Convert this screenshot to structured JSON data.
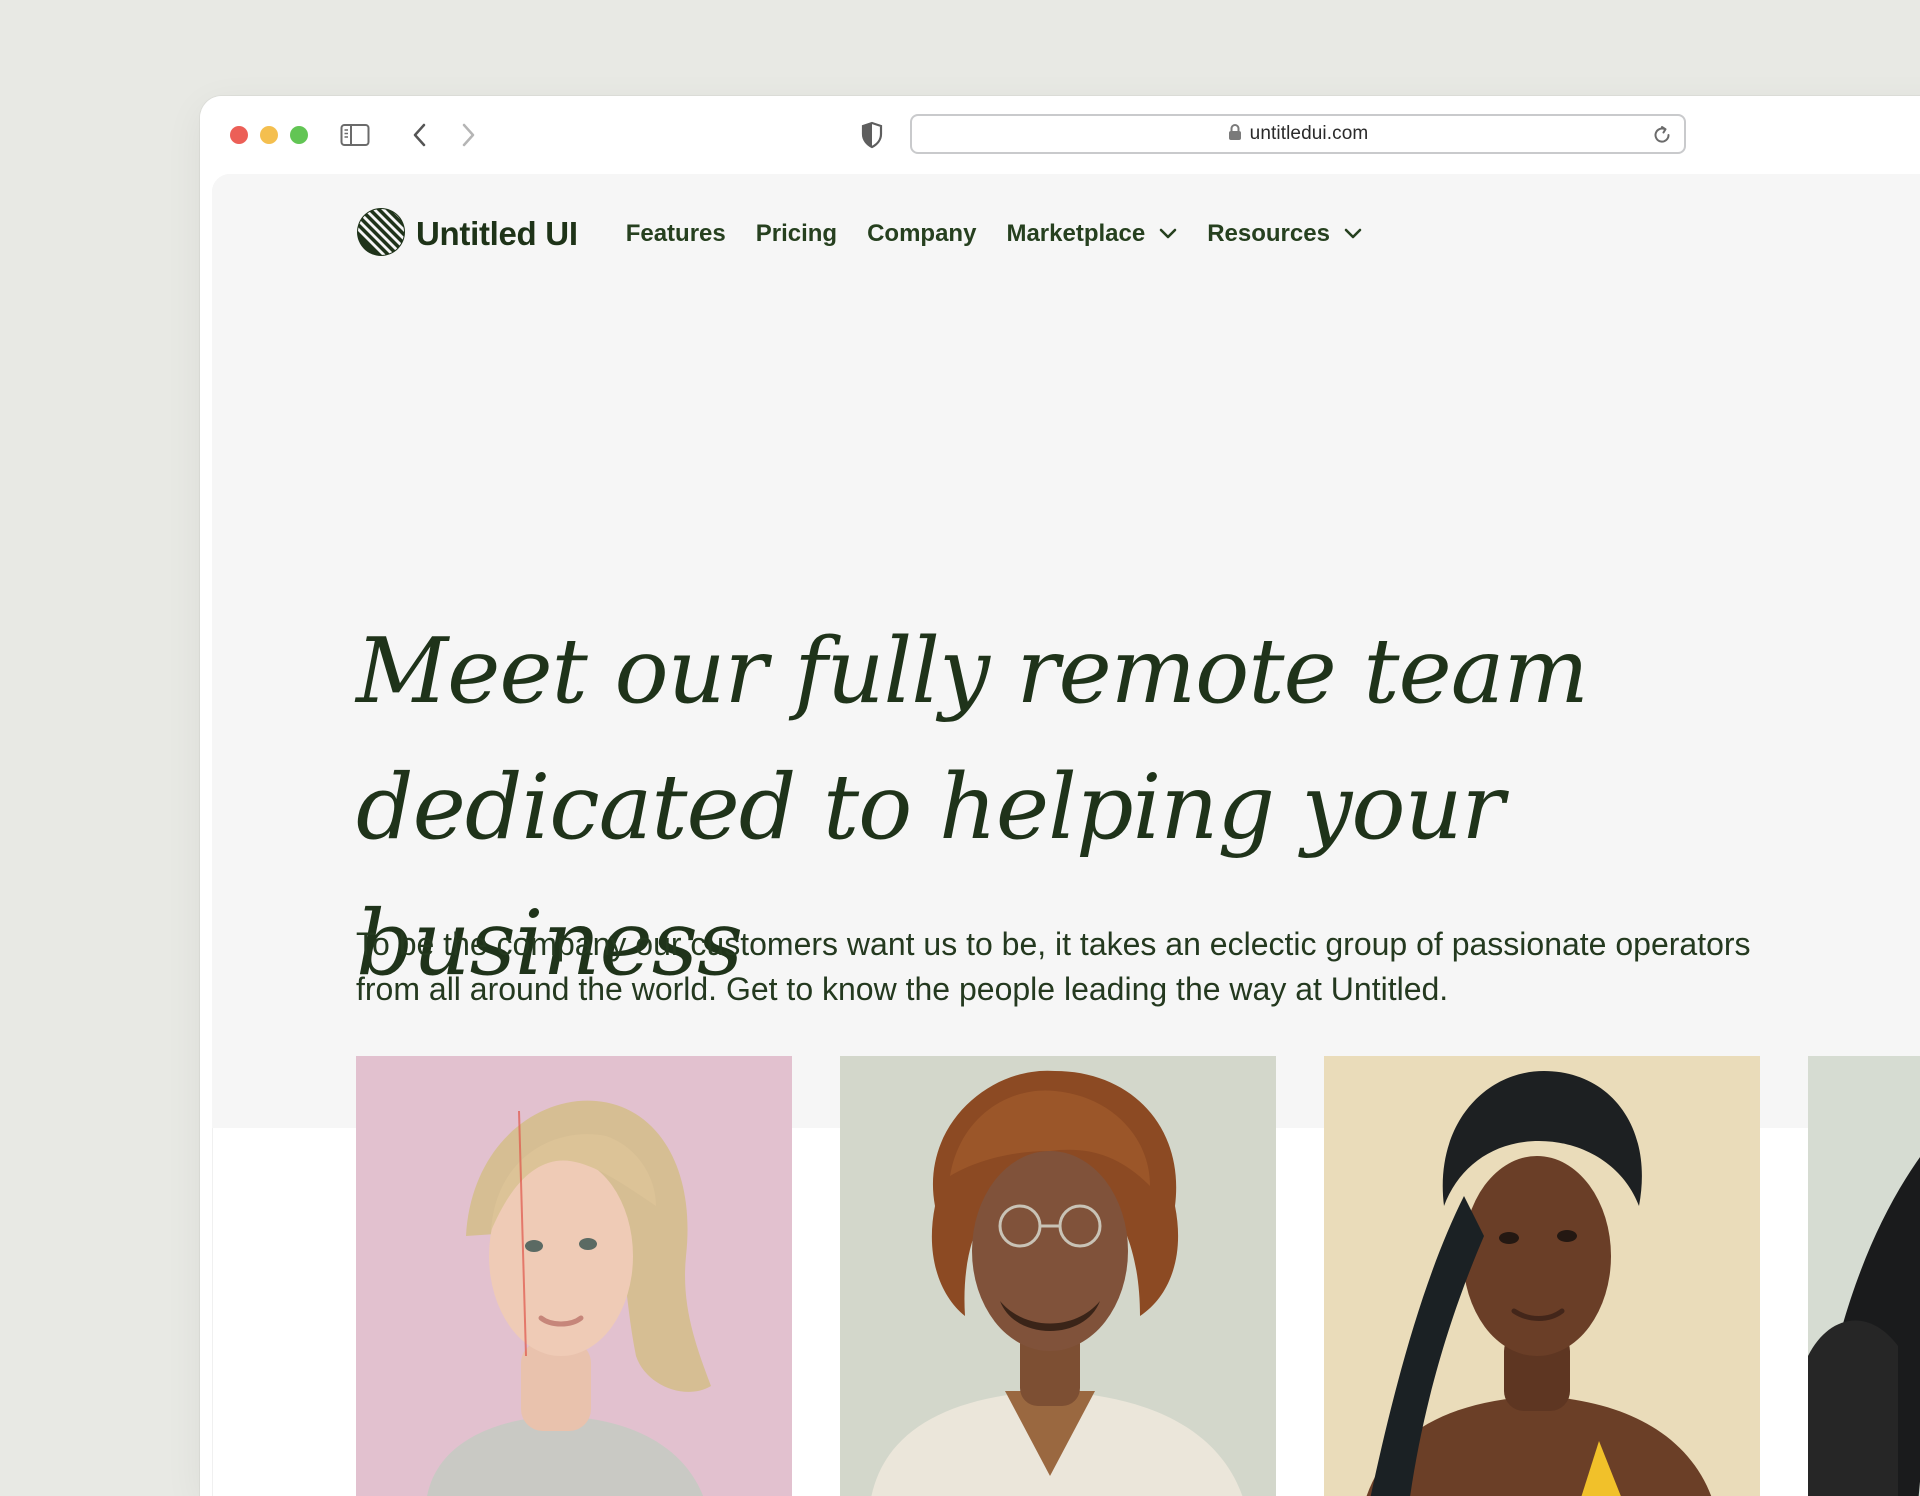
{
  "browser": {
    "url": "untitledui.com",
    "icons": [
      "sidebar-icon",
      "back-icon",
      "forward-icon",
      "shield-icon",
      "lock-icon",
      "reload-icon"
    ]
  },
  "nav": {
    "logo_text": "Untitled UI",
    "items": [
      {
        "label": "Features",
        "has_dropdown": false
      },
      {
        "label": "Pricing",
        "has_dropdown": false
      },
      {
        "label": "Company",
        "has_dropdown": false
      },
      {
        "label": "Marketplace",
        "has_dropdown": true
      },
      {
        "label": "Resources",
        "has_dropdown": true
      }
    ]
  },
  "hero": {
    "headline_line1": "Meet our fully remote team",
    "headline_line2": "dedicated to helping your business",
    "subtext": "To be the company our customers want us to be, it takes an eclectic group of passionate operators from all around the world. Get to know the people leading the way at Untitled."
  },
  "team": [
    {
      "photo_background": "#e2c1cf"
    },
    {
      "photo_background": "#d3d7cb"
    },
    {
      "photo_background": "#eadcba"
    },
    {
      "photo_background": "#d6dcd2"
    }
  ],
  "colors": {
    "page_background": "#e8e9e4",
    "hero_background": "#f6f6f6",
    "brand_text": "#1f331a"
  }
}
